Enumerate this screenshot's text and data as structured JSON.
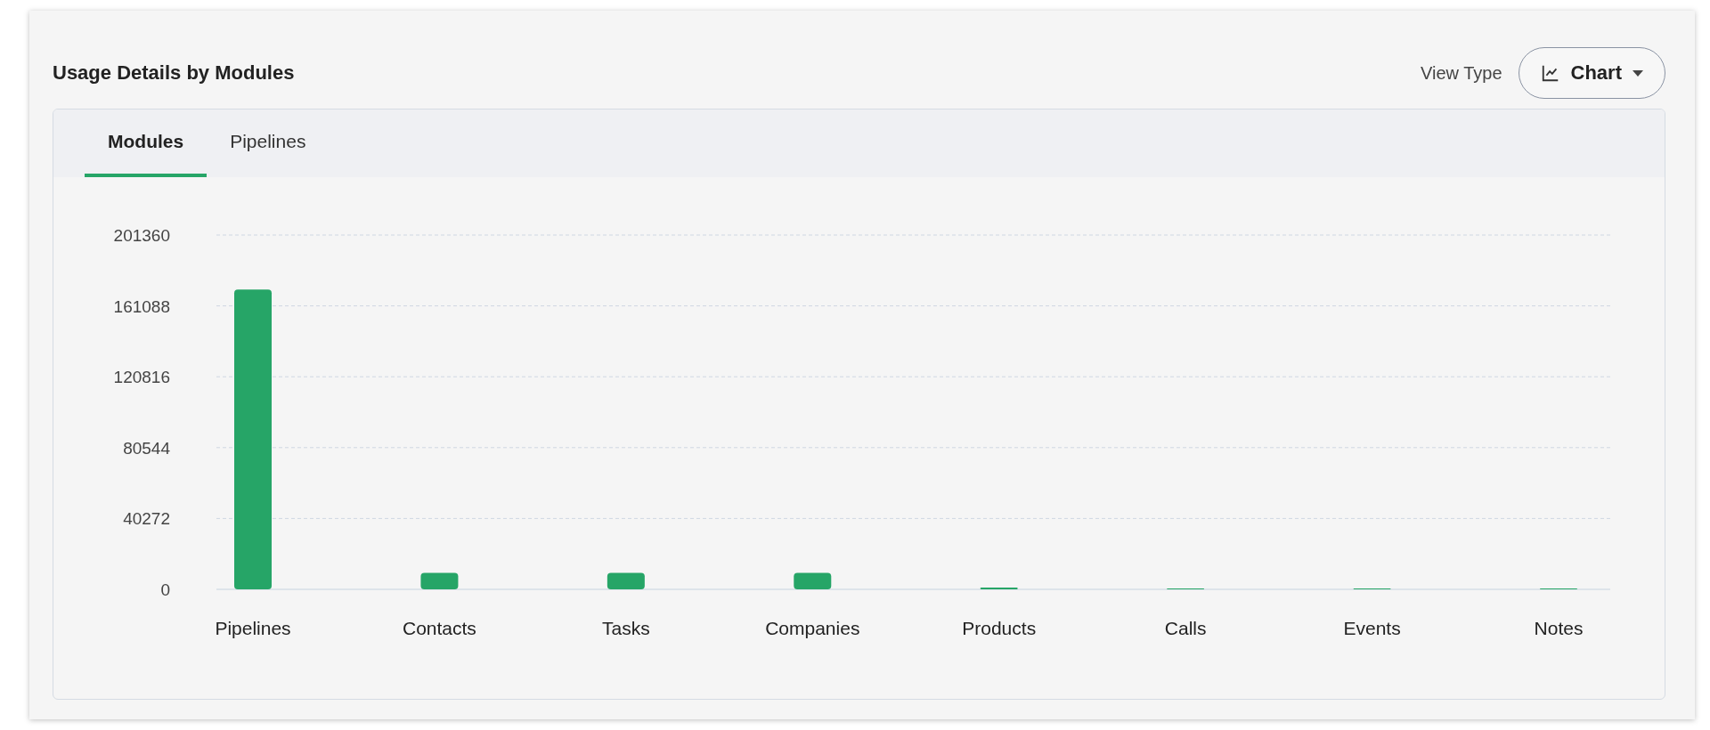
{
  "header": {
    "title": "Usage Details by Modules",
    "view_type_label": "View Type",
    "view_type_value": "Chart"
  },
  "tabs": [
    {
      "label": "Modules",
      "selected": true
    },
    {
      "label": "Pipelines",
      "selected": false
    }
  ],
  "chart_data": {
    "type": "bar",
    "categories": [
      "Pipelines",
      "Contacts",
      "Tasks",
      "Companies",
      "Products",
      "Calls",
      "Events",
      "Notes"
    ],
    "series": [
      {
        "color": "#26a567",
        "values": [
          170400,
          9300,
          9300,
          9300,
          1000,
          500,
          500,
          500
        ]
      }
    ],
    "grid": true,
    "ylim": [
      0,
      201360
    ],
    "yticks": [
      0,
      40272,
      80544,
      120816,
      161088,
      201360
    ]
  }
}
